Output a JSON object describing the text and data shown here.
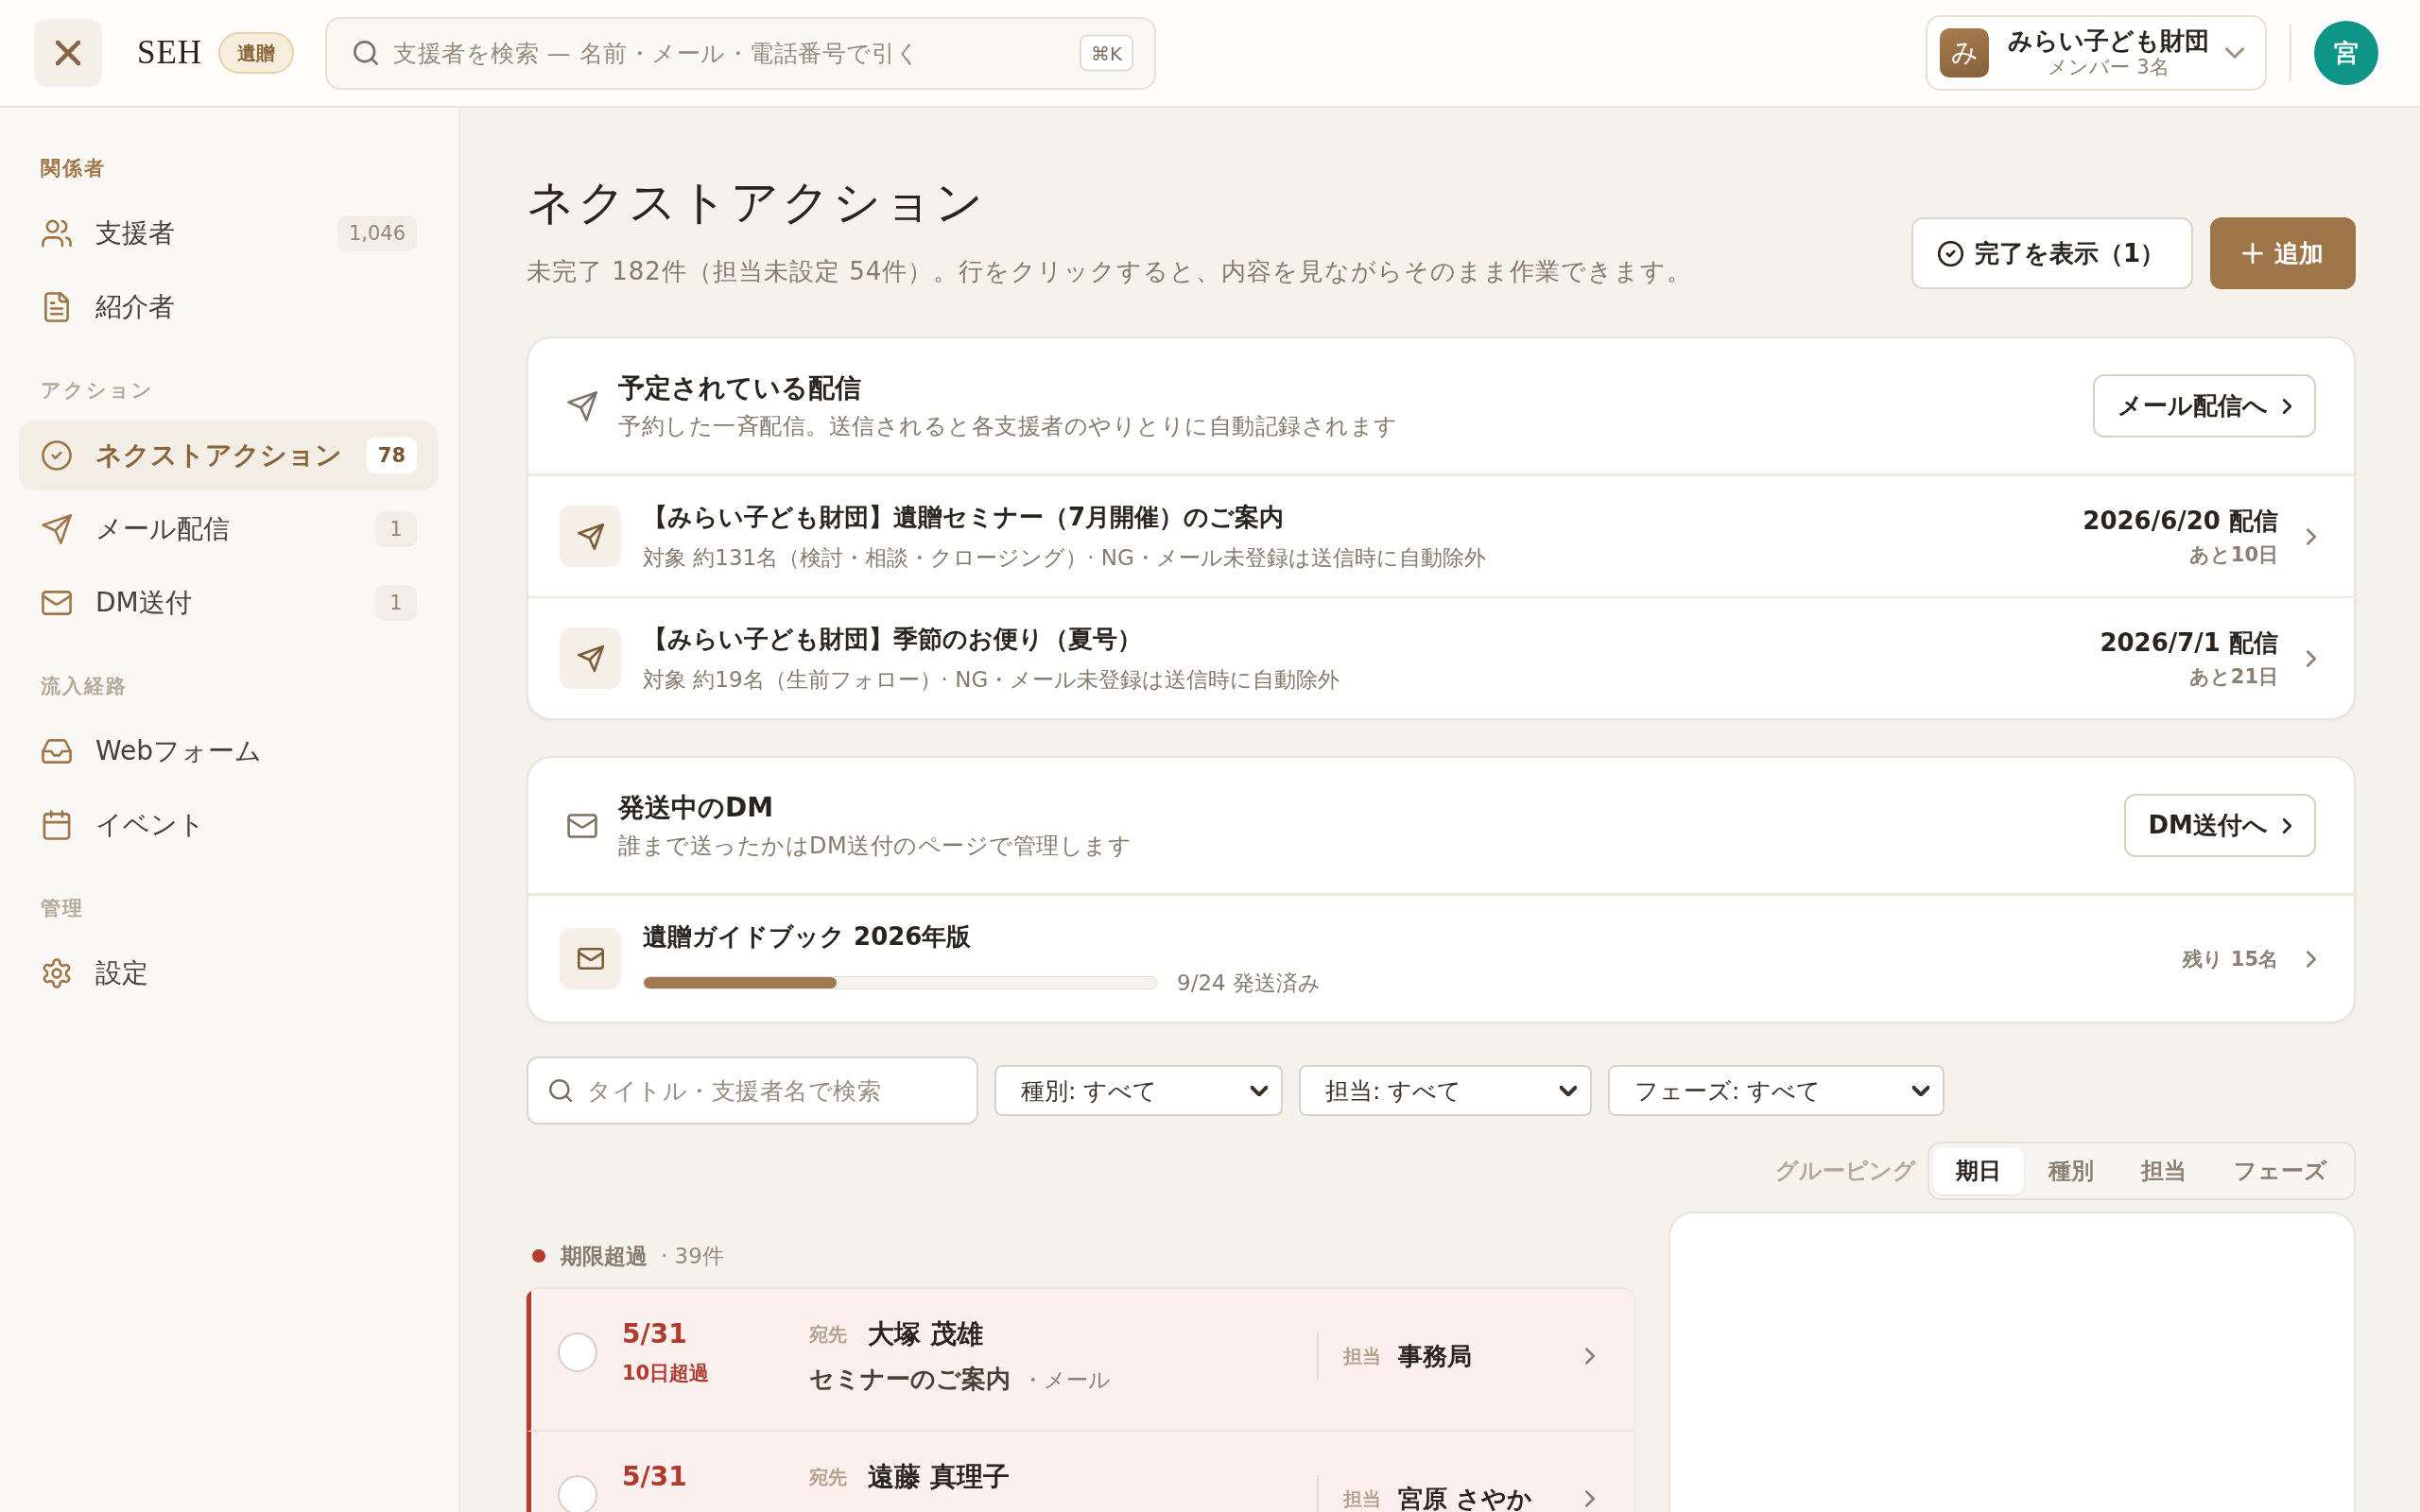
{
  "header": {
    "app_name": "SEH",
    "badge": "遺贈",
    "search": {
      "placeholder": "支援者を検索 — 名前・メール・電話番号で引く",
      "shortcut": "⌘K"
    },
    "organization": {
      "initial": "み",
      "name": "みらい子ども財団",
      "members": "メンバー 3名"
    },
    "user": {
      "initial": "宮"
    }
  },
  "sidebar": {
    "sections": [
      {
        "label": "関係者",
        "highlighted": true,
        "items": [
          {
            "label": "支援者",
            "count": "1,046",
            "selected": false
          },
          {
            "label": "紹介者",
            "selected": false
          }
        ]
      },
      {
        "label": "アクション",
        "highlighted": false,
        "items": [
          {
            "label": "ネクストアクション",
            "count": "78",
            "selected": true
          },
          {
            "label": "メール配信",
            "count": "1",
            "selected": false
          },
          {
            "label": "DM送付",
            "count": "1",
            "selected": false
          }
        ]
      },
      {
        "label": "流入経路",
        "highlighted": false,
        "items": [
          {
            "label": "Webフォーム",
            "selected": false
          },
          {
            "label": "イベント",
            "selected": false
          }
        ]
      },
      {
        "label": "管理",
        "highlighted": false,
        "items": [
          {
            "label": "設定",
            "selected": false
          }
        ]
      }
    ]
  },
  "page": {
    "title": "ネクストアクション",
    "description": "未完了 182件（担当未設定 54件）。行をクリックすると、内容を見ながらそのまま作業できます。",
    "actions": [
      {
        "label": "完了を表示（1）",
        "kind": "secondary"
      },
      {
        "label": "追加",
        "kind": "primary"
      }
    ]
  },
  "scheduled_deliveries": {
    "title": "予定されている配信",
    "description": "予約した一斉配信。送信されると各支援者のやりとりに自動記録されます",
    "link": "メール配信へ",
    "items": [
      {
        "title": "【みらい子ども財団】遺贈セミナー（7月開催）のご案内",
        "audience": "対象 約131名（検討・相談・クロージング）· NG・メール未登録は送信時に自動除外",
        "date": "2026/6/20 配信",
        "remaining": "あと10日"
      },
      {
        "title": "【みらい子ども財団】季節のお便り（夏号）",
        "audience": "対象 約19名（生前フォロー）· NG・メール未登録は送信時に自動除外",
        "date": "2026/7/1 配信",
        "remaining": "あと21日"
      }
    ]
  },
  "dm_shipments": {
    "title": "発送中のDM",
    "description": "誰まで送ったかはDM送付のページで管理します",
    "link": "DM送付へ",
    "items": [
      {
        "title": "遺贈ガイドブック 2026年版",
        "level": 0.375,
        "progress": "9/24 発送済み",
        "remaining": "残り 15名"
      }
    ]
  },
  "filters": {
    "search": {
      "placeholder": "タイトル・支援者名で検索"
    },
    "dropdowns": [
      "種別: すべて",
      "担当: すべて",
      "フェーズ: すべて"
    ]
  },
  "grouping": {
    "label": "グルーピング",
    "options": [
      {
        "label": "期日",
        "selected": true
      },
      {
        "label": "種別",
        "selected": false
      },
      {
        "label": "担当",
        "selected": false
      },
      {
        "label": "フェーズ",
        "selected": false
      }
    ]
  },
  "groups": [
    {
      "label": "期限超過",
      "count": "· 39件",
      "color": "#b8392e",
      "rows": [
        {
          "checked": false,
          "overdue": true,
          "date": "5/31",
          "overdue_label": "10日超過",
          "recipient_label": "宛先",
          "recipient": "大塚 茂雄",
          "title": "セミナーのご案内",
          "channel": "・メール",
          "assignee_label": "担当",
          "assignee": "事務局"
        },
        {
          "checked": false,
          "overdue": true,
          "date": "5/31",
          "recipient_label": "宛先",
          "recipient": "遠藤 真理子",
          "assignee_label": "担当",
          "assignee": "宮原 さやか"
        }
      ]
    }
  ]
}
